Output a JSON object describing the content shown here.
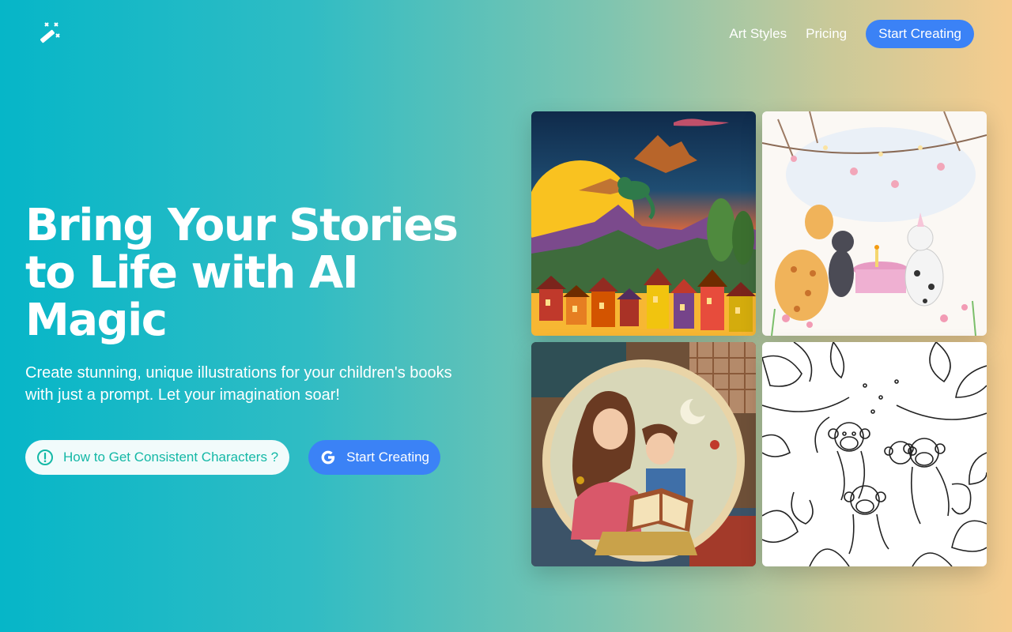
{
  "header": {
    "logo_icon": "magic-wand-icon",
    "nav": [
      {
        "label": "Art Styles"
      },
      {
        "label": "Pricing"
      }
    ],
    "cta_label": "Start Creating"
  },
  "hero": {
    "title": "Bring Your Stories to Life with AI Magic",
    "subtitle": "Create stunning, unique illustrations for your children's books with just a prompt. Let your imagination soar!",
    "help_button": {
      "label": "How to Get Consistent Characters ?",
      "icon": "info-circle-icon"
    },
    "start_button": {
      "label": "Start Creating",
      "icon": "google-icon"
    }
  },
  "gallery": {
    "images": [
      {
        "icon": "dragon-village-illustration"
      },
      {
        "icon": "animal-party-illustration"
      },
      {
        "icon": "mother-child-reading-illustration"
      },
      {
        "icon": "monkeys-coloring-page-illustration"
      }
    ]
  },
  "colors": {
    "primary_button": "#3b82f6",
    "teal_text": "#14b8a6",
    "gradient_start": "#06b6c8",
    "gradient_end": "#f6cc8e"
  }
}
